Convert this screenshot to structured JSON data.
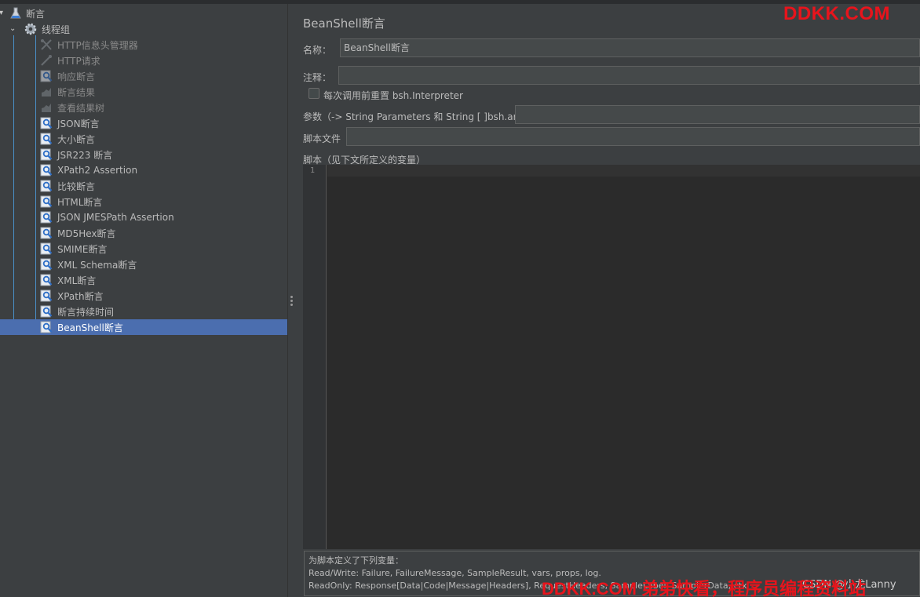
{
  "tree": {
    "root": {
      "label": "断言",
      "icon": "flask-icon"
    },
    "thread_group": {
      "label": "线程组",
      "icon": "gear-icon"
    },
    "items": [
      {
        "label": "HTTP信息头管理器",
        "icon": "wrench-icon",
        "dim": true
      },
      {
        "label": "HTTP请求",
        "icon": "pipette-icon",
        "dim": true
      },
      {
        "label": "响应断言",
        "icon": "assertion-icon",
        "dim": true
      },
      {
        "label": "断言结果",
        "icon": "chart-icon",
        "dim": true
      },
      {
        "label": "查看结果树",
        "icon": "chart-icon",
        "dim": true
      },
      {
        "label": "JSON断言",
        "icon": "assertion-icon",
        "dim": false
      },
      {
        "label": "大小断言",
        "icon": "assertion-icon",
        "dim": false
      },
      {
        "label": "JSR223 断言",
        "icon": "assertion-icon",
        "dim": false
      },
      {
        "label": "XPath2 Assertion",
        "icon": "assertion-icon",
        "dim": false
      },
      {
        "label": "比较断言",
        "icon": "assertion-icon",
        "dim": false
      },
      {
        "label": "HTML断言",
        "icon": "assertion-icon",
        "dim": false
      },
      {
        "label": "JSON JMESPath Assertion",
        "icon": "assertion-icon",
        "dim": false
      },
      {
        "label": "MD5Hex断言",
        "icon": "assertion-icon",
        "dim": false
      },
      {
        "label": "SMIME断言",
        "icon": "assertion-icon",
        "dim": false
      },
      {
        "label": "XML Schema断言",
        "icon": "assertion-icon",
        "dim": false
      },
      {
        "label": "XML断言",
        "icon": "assertion-icon",
        "dim": false
      },
      {
        "label": "XPath断言",
        "icon": "assertion-icon",
        "dim": false
      },
      {
        "label": "断言持续时间",
        "icon": "assertion-icon",
        "dim": false
      },
      {
        "label": "BeanShell断言",
        "icon": "assertion-icon",
        "dim": false,
        "selected": true
      }
    ]
  },
  "panel": {
    "title": "BeanShell断言",
    "name_label": "名称：",
    "name_value": "BeanShell断言",
    "comment_label": "注释：",
    "comment_value": "",
    "reset_checkbox_label": "每次调用前重置 bsh.Interpreter",
    "params_label": "参数（-> String Parameters 和 String [ ]bsh.args）",
    "params_value": "",
    "script_file_label": "脚本文件",
    "script_file_value": "",
    "script_label": "脚本（见下文所定义的变量）",
    "line_number": "1",
    "info_lines": [
      "为脚本定义了下列变量：",
      "Read/Write: Failure, FailureMessage, SampleResult, vars, props, log.",
      "ReadOnly: Response[Data|Code|Message|Headers], RequestHeaders, SampleLabel, SamplerData, ctx"
    ]
  },
  "watermarks": {
    "top": "DDKK.COM",
    "bottom": "DDKK.COM 弟弟快看，程序员编程资料站",
    "csdn": "CSDN @小龙Lanny"
  },
  "colors": {
    "selection": "#4b6eaf",
    "watermark": "#e8141c",
    "tree_line": "#4a90c8"
  }
}
